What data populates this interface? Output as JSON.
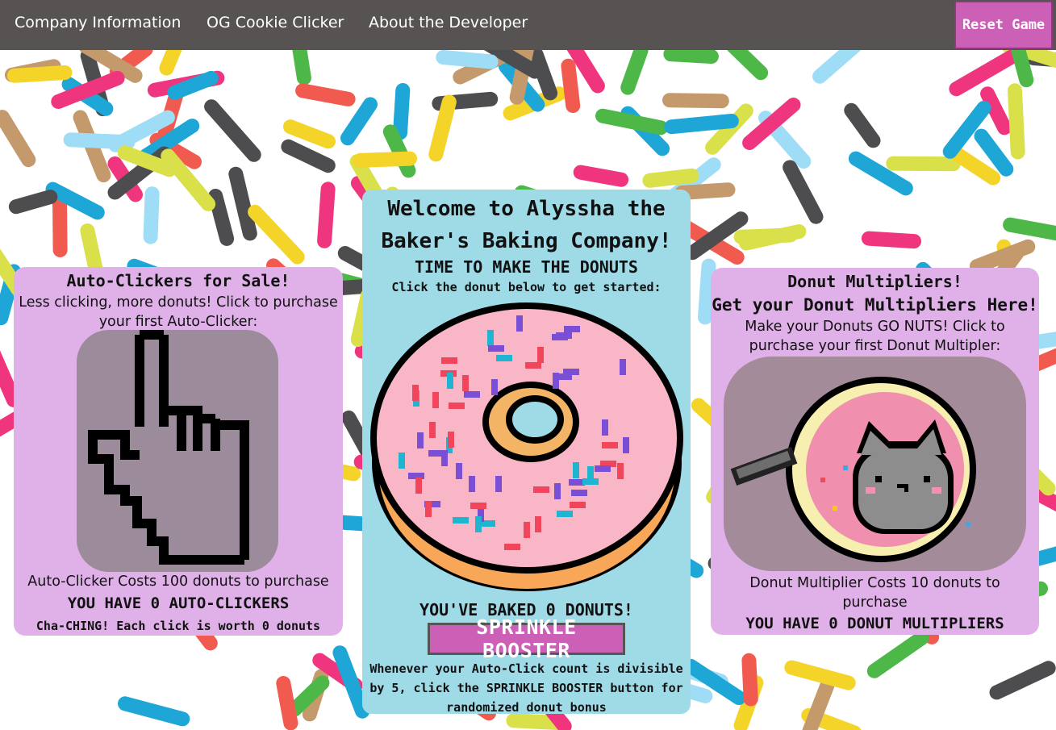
{
  "nav": {
    "links": [
      "Company Information",
      "OG Cookie Clicker",
      "About the Developer"
    ],
    "reset_label": "Reset Game"
  },
  "left": {
    "title": "Auto-Clickers for Sale!",
    "desc": "Less clicking, more donuts! Click to purchase your first Auto-Clicker:",
    "image_icon": "pixel-hand-cursor-icon",
    "cost": "Auto-Clicker Costs 100 donuts to purchase",
    "count": "YOU HAVE 0 AUTO-CLICKERS",
    "worth": "Cha-CHING! Each click is worth 0 donuts"
  },
  "center": {
    "title": "Welcome to Alyssha the Baker's Baking Company!",
    "subtitle": "TIME TO MAKE THE DONUTS",
    "instruction": "Click the donut below to get started:",
    "image_icon": "pixel-donut-icon",
    "baked": "YOU'VE BAKED 0 DONUTS!",
    "booster_label": "SPRINKLE BOOSTER",
    "booster_note": "Whenever your Auto-Click count is divisible by 5, click the SPRINKLE BOOSTER button for randomized donut bonus"
  },
  "right": {
    "title": "Donut Multipliers!",
    "subtitle": "Get your Donut Multipliers Here!",
    "desc": "Make your Donuts GO NUTS! Click to purchase your first Donut Multipler:",
    "image_icon": "pusheen-donut-cat-icon",
    "cost": "Donut Multiplier Costs 10 donuts to purchase",
    "count": "YOU HAVE 0 DONUT MULTIPLIERS"
  },
  "colors": {
    "navbar": "#575352",
    "button_pink": "#cc5fb6",
    "card_purple": "#e0b1e8",
    "card_blue": "#9fdbe7",
    "sprinkles": [
      "#1ea6d6",
      "#f0357f",
      "#4db847",
      "#f5d42a",
      "#f15a4f",
      "#4d4d4f",
      "#c49a6c",
      "#9fdcf5",
      "#d9e04a"
    ]
  }
}
